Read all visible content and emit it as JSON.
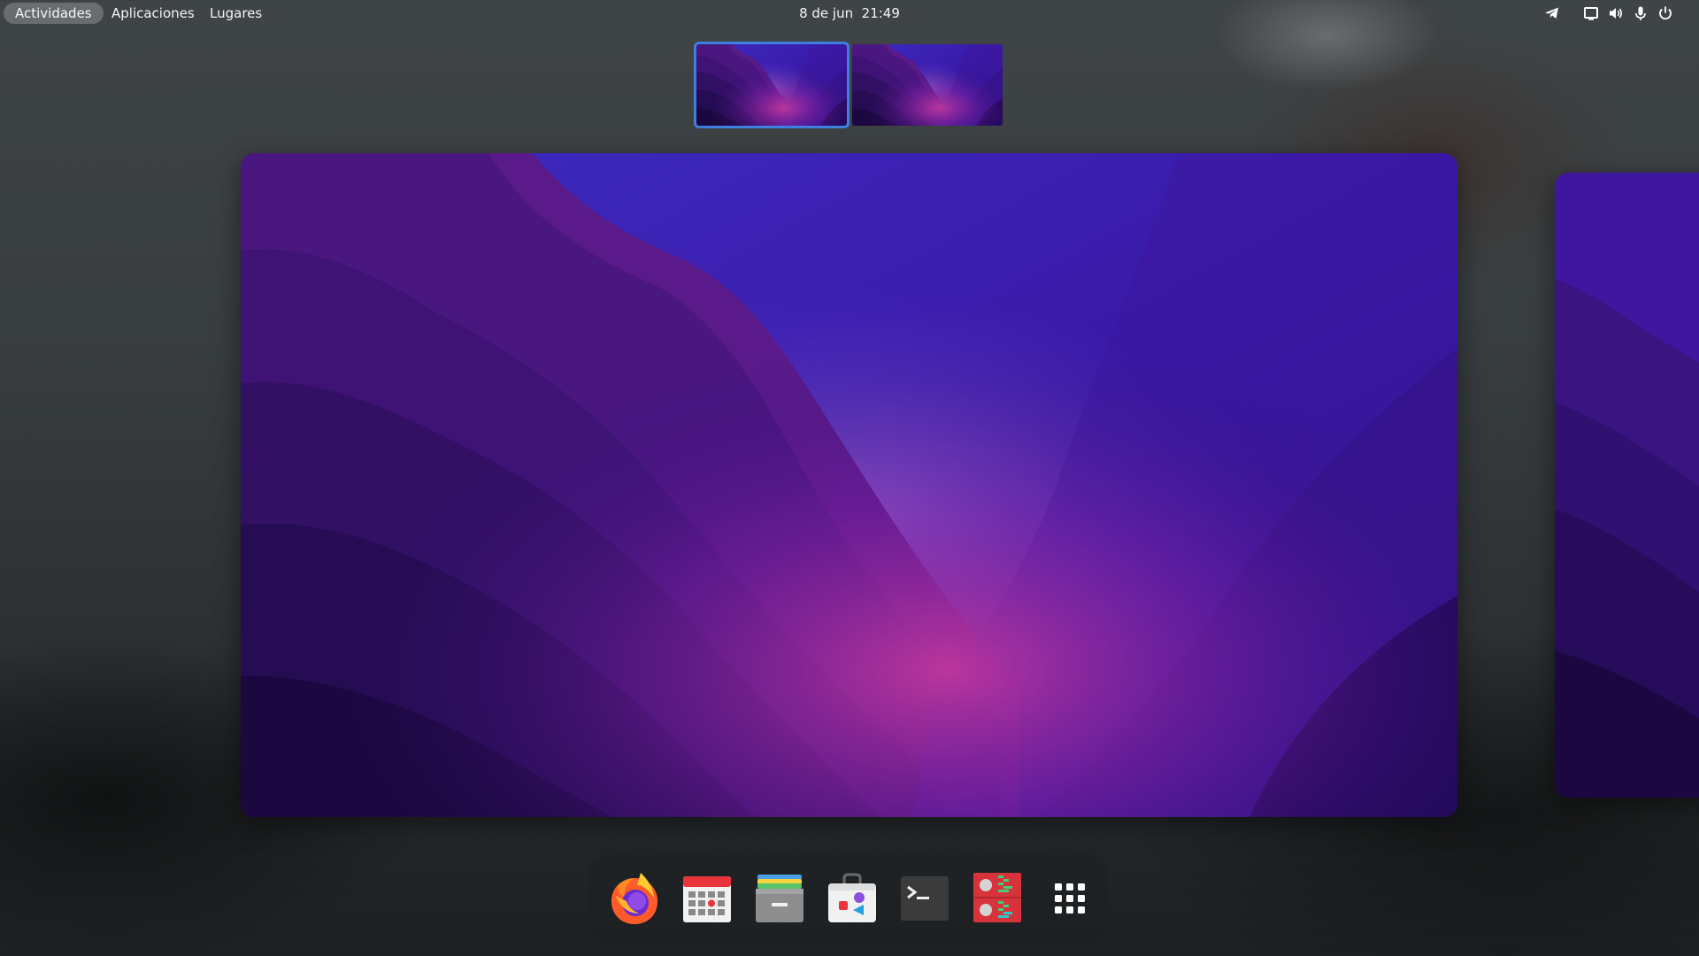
{
  "topbar": {
    "activities": "Actividades",
    "applications": "Aplicaciones",
    "places": "Lugares",
    "date": "8 de jun",
    "time": "21:49",
    "tray": [
      "telegram-icon",
      "screen-icon",
      "volume-icon",
      "microphone-icon",
      "power-icon"
    ]
  },
  "workspaces": {
    "count": 2,
    "active_index": 0,
    "highlight_color": "#3f7fe0"
  },
  "dash": {
    "apps": [
      {
        "id": "firefox",
        "icon": "firefox-icon"
      },
      {
        "id": "calendar",
        "icon": "calendar-icon"
      },
      {
        "id": "files",
        "icon": "files-icon"
      },
      {
        "id": "software",
        "icon": "software-center-icon"
      },
      {
        "id": "terminal",
        "icon": "terminal-icon"
      },
      {
        "id": "archive",
        "icon": "archive-manager-icon"
      }
    ],
    "show_apps": "app-grid-icon"
  },
  "colors": {
    "wallpaper_deep": "#1e0a45",
    "wallpaper_mid": "#3b1470",
    "wallpaper_light": "#5a2ec8",
    "wallpaper_pink": "#b0369e"
  }
}
